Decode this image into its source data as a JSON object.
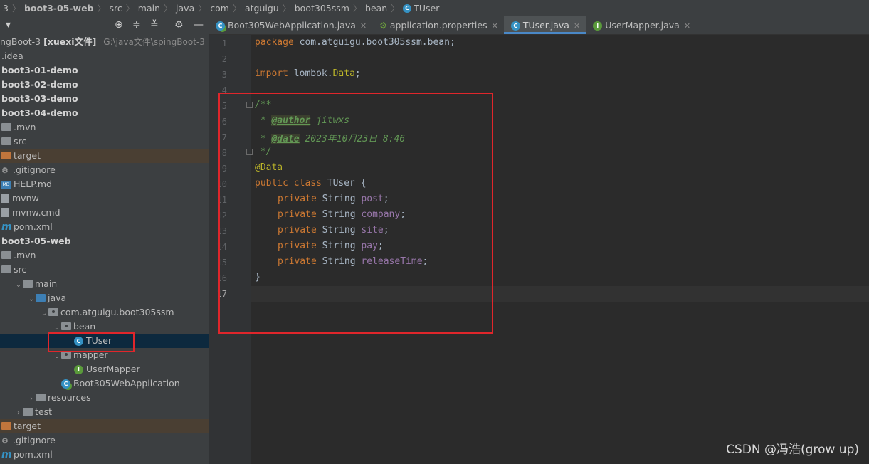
{
  "breadcrumb": [
    "3",
    "boot3-05-web",
    "src",
    "main",
    "java",
    "com",
    "atguigu",
    "boot305ssm",
    "bean",
    "TUser"
  ],
  "sidebar": {
    "root_label": "ngBoot-3",
    "root_module": "[xuexi文件]",
    "root_path": "G:\\java文件\\spingBoot-3",
    "tree": [
      {
        "label": ".idea",
        "indent": 0,
        "icon": "none"
      },
      {
        "label": "boot3-01-demo",
        "indent": 0,
        "icon": "none",
        "bold": true
      },
      {
        "label": "boot3-02-demo",
        "indent": 0,
        "icon": "none",
        "bold": true
      },
      {
        "label": "boot3-03-demo",
        "indent": 0,
        "icon": "none",
        "bold": true
      },
      {
        "label": "boot3-04-demo",
        "indent": 0,
        "icon": "none",
        "bold": true
      },
      {
        "label": ".mvn",
        "indent": 0,
        "icon": "folder"
      },
      {
        "label": "src",
        "indent": 0,
        "icon": "folder"
      },
      {
        "label": "target",
        "indent": 0,
        "icon": "folder-orange",
        "highlight": "target"
      },
      {
        "label": ".gitignore",
        "indent": 0,
        "icon": "gitignore"
      },
      {
        "label": "HELP.md",
        "indent": 0,
        "icon": "md"
      },
      {
        "label": "mvnw",
        "indent": 0,
        "icon": "file"
      },
      {
        "label": "mvnw.cmd",
        "indent": 0,
        "icon": "file"
      },
      {
        "label": "pom.xml",
        "indent": 0,
        "icon": "maven"
      },
      {
        "label": "boot3-05-web",
        "indent": 0,
        "icon": "none",
        "bold": true
      },
      {
        "label": ".mvn",
        "indent": 0,
        "icon": "folder"
      },
      {
        "label": "src",
        "indent": 0,
        "icon": "folder"
      },
      {
        "label": "main",
        "indent": 1,
        "icon": "folder",
        "arrow": "down"
      },
      {
        "label": "java",
        "indent": 2,
        "icon": "folder-blue",
        "arrow": "down"
      },
      {
        "label": "com.atguigu.boot305ssm",
        "indent": 3,
        "icon": "package",
        "arrow": "down"
      },
      {
        "label": "bean",
        "indent": 4,
        "icon": "package",
        "arrow": "down"
      },
      {
        "label": "TUser",
        "indent": 5,
        "icon": "class",
        "highlight": "selected"
      },
      {
        "label": "mapper",
        "indent": 4,
        "icon": "package",
        "arrow": "down"
      },
      {
        "label": "UserMapper",
        "indent": 5,
        "icon": "interface"
      },
      {
        "label": "Boot305WebApplication",
        "indent": 4,
        "icon": "boot"
      },
      {
        "label": "resources",
        "indent": 2,
        "icon": "folder",
        "arrow": "right"
      },
      {
        "label": "test",
        "indent": 1,
        "icon": "folder",
        "arrow": "right"
      },
      {
        "label": "target",
        "indent": 0,
        "icon": "folder-orange",
        "highlight": "target"
      },
      {
        "label": ".gitignore",
        "indent": 0,
        "icon": "gitignore"
      },
      {
        "label": "pom.xml",
        "indent": 0,
        "icon": "maven"
      }
    ]
  },
  "tabs": [
    {
      "label": "Boot305WebApplication.java",
      "icon": "boot",
      "active": false
    },
    {
      "label": "application.properties",
      "icon": "props",
      "active": false
    },
    {
      "label": "TUser.java",
      "icon": "class",
      "active": true
    },
    {
      "label": "UserMapper.java",
      "icon": "interface",
      "active": false
    }
  ],
  "editor": {
    "line_numbers": [
      "1",
      "2",
      "3",
      "4",
      "5",
      "6",
      "7",
      "8",
      "9",
      "10",
      "11",
      "12",
      "13",
      "14",
      "15",
      "16",
      "17"
    ],
    "current_line": "17",
    "code": {
      "l1_kw": "package",
      "l1_rest": " com.atguigu.boot305ssm.bean;",
      "l3_kw": "import",
      "l3_pkg": " lombok.",
      "l3_cls": "Data",
      "l3_semi": ";",
      "l5": "/**",
      "l6_star": " * ",
      "l6_tag": "@author",
      "l6_val": " jitwxs",
      "l7_star": " * ",
      "l7_tag": "@date",
      "l7_val": " 2023年10月23日 8:46",
      "l8": " */",
      "l9": "@Data",
      "l10_kw": "public class",
      "l10_rest": " TUser {",
      "fields": [
        {
          "kw": "private",
          "type": " String ",
          "name": "post"
        },
        {
          "kw": "private",
          "type": " String ",
          "name": "company"
        },
        {
          "kw": "private",
          "type": " String ",
          "name": "site"
        },
        {
          "kw": "private",
          "type": " String ",
          "name": "pay"
        },
        {
          "kw": "private",
          "type": " String ",
          "name": "releaseTime"
        }
      ],
      "l16": "}"
    }
  },
  "watermark": "CSDN @冯浩(grow up)"
}
